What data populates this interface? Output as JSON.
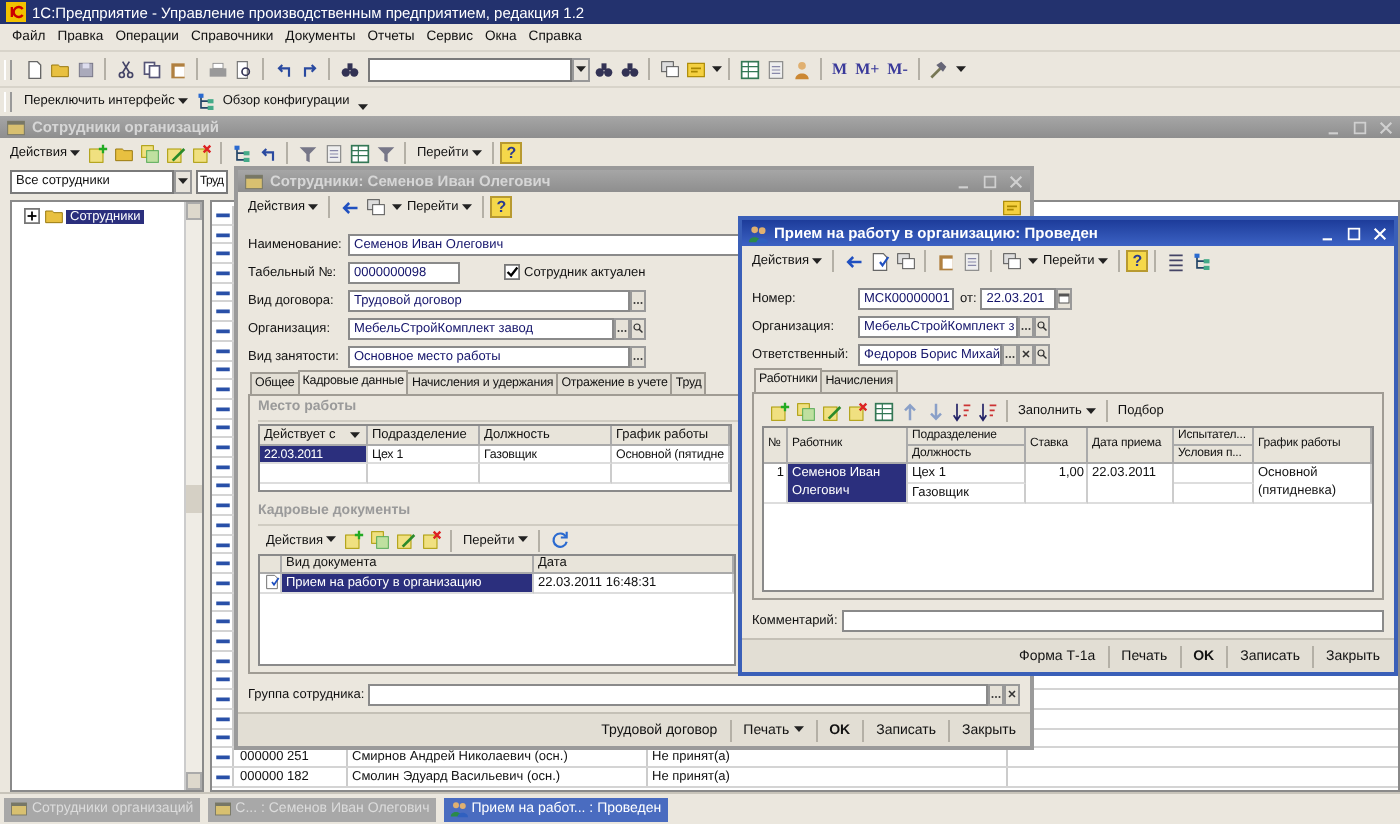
{
  "app_window": {
    "title": "1С:Предприятие - Управление производственным предприятием, редакция 1.2"
  },
  "menu": [
    "Файл",
    "Правка",
    "Операции",
    "Справочники",
    "Документы",
    "Отчеты",
    "Сервис",
    "Окна",
    "Справка"
  ],
  "toolbar": {
    "memory_buttons": [
      "M",
      "M+",
      "M-"
    ]
  },
  "panel": [
    {
      "label": "Переключить интерфейс",
      "kind": "menu"
    },
    {
      "label": "Обзор конфигурации",
      "kind": "link"
    }
  ],
  "employees_window": {
    "title": "Сотрудники организаций",
    "active": false,
    "actions": "Действия",
    "goto": "Перейти",
    "help": "?",
    "filter": "Все сотрудники",
    "filter_2": "Труд",
    "tree": [
      {
        "label": "Сотрудники",
        "expanded": false,
        "selected": true
      }
    ],
    "rows": [
      {
        "code": "000000 251",
        "name": "Смирнов Андрей Николаевич (осн.)",
        "status": "Не принят(а)"
      },
      {
        "code": "000000 182",
        "name": "Смолин Эдуард Васильевич (осн.)",
        "status": "Не принят(а)"
      }
    ]
  },
  "employee_form": {
    "title": "Сотрудники: Семенов Иван Олегович",
    "active": false,
    "actions": "Действия",
    "goto": "Перейти",
    "help": "?",
    "fields": [
      {
        "label": "Наименование:",
        "value": "Семенов Иван Олегович",
        "kind": "text"
      },
      {
        "label": "Табельный №:",
        "value": "0000000098",
        "kind": "short"
      },
      {
        "label": "Вид договора:",
        "value": "Трудовой договор",
        "kind": "select"
      },
      {
        "label": "Организация:",
        "value": "МебельСтройКомплект завод",
        "kind": "lookup"
      },
      {
        "label": "Вид занятости:",
        "value": "Основное место работы",
        "kind": "select"
      }
    ],
    "active_checkbox": {
      "label": "Сотрудник актуален",
      "checked": true
    },
    "tabs": [
      {
        "label": "Общее",
        "selected": false
      },
      {
        "label": "Кадровые данные",
        "selected": true
      },
      {
        "label": "Начисления и удержания",
        "selected": false
      },
      {
        "label": "Отражение в учете",
        "selected": false
      },
      {
        "label": "Труд",
        "selected": false
      }
    ],
    "workplace": {
      "title": "Место работы",
      "columns": [
        "Действует с",
        "Подразделение",
        "Должность",
        "График работы"
      ],
      "rows": [
        {
          "cells": [
            "22.03.2011",
            "Цех 1",
            "Газовщик",
            "Основной (пятидне"
          ],
          "selected": true
        }
      ]
    },
    "hr_documents": {
      "title": "Кадровые документы",
      "actions": "Действия",
      "goto": "Перейти",
      "columns": [
        "Вид документа",
        "Дата"
      ],
      "rows": [
        {
          "cells": [
            "Прием на работу в организацию",
            "22.03.2011 16:48:31"
          ],
          "selected": true
        }
      ]
    },
    "group": {
      "label": "Группа сотрудника:",
      "kind": "choice_clear"
    },
    "buttons": [
      {
        "label": "Трудовой договор",
        "kind": "plain"
      },
      {
        "label": "Печать",
        "kind": "menu"
      },
      {
        "label": "OK",
        "kind": "default"
      },
      {
        "label": "Записать",
        "kind": "plain"
      },
      {
        "label": "Закрыть",
        "kind": "plain"
      }
    ]
  },
  "document_form": {
    "title": "Прием на работу в организацию: Проведен",
    "active": true,
    "actions": "Действия",
    "goto": "Перейти",
    "help": "?",
    "number": {
      "label": "Номер:",
      "value": "МСК00000001"
    },
    "date": {
      "label": "от:",
      "value": "22.03.201"
    },
    "fields": [
      {
        "label": "Организация:",
        "value": "МебельСтройКомплект з",
        "kind": "lookup"
      },
      {
        "label": "Ответственный:",
        "value": "Федоров Борис Михай",
        "kind": "lookup_clear"
      }
    ],
    "tabs": [
      {
        "label": "Работники",
        "selected": true
      },
      {
        "label": "Начисления",
        "selected": false
      }
    ],
    "fill": "Заполнить",
    "pick": "Подбор",
    "columns": [
      {
        "top": "№"
      },
      {
        "top": "Работник"
      },
      {
        "top": "Подразделение",
        "bottom": "Должность"
      },
      {
        "top": "Ставка"
      },
      {
        "top": "Дата приема"
      },
      {
        "top": "Испытател...",
        "bottom": "Условия п..."
      },
      {
        "top": "График работы"
      }
    ],
    "rows": [
      {
        "cells": [
          {
            "text": "1",
            "kind": "number",
            "selected": false
          },
          {
            "text": "Семенов Иван Олегович",
            "kind": "text",
            "selected": true
          },
          {
            "text": "Цех 1",
            "text2": "Газовщик",
            "kind": "text",
            "selected": false
          },
          {
            "text": "1,00",
            "kind": "number",
            "selected": false
          },
          {
            "text": "22.03.2011",
            "kind": "text",
            "selected": false
          },
          {
            "kind": "text",
            "selected": false
          },
          {
            "text": "Основной (пятидневка)",
            "kind": "text",
            "selected": false
          }
        ]
      }
    ],
    "comment": {
      "label": "Комментарий:"
    },
    "buttons": [
      {
        "label": "Форма Т-1а",
        "kind": "plain"
      },
      {
        "label": "Печать",
        "kind": "plain"
      },
      {
        "label": "OK",
        "kind": "default"
      },
      {
        "label": "Записать",
        "kind": "plain"
      },
      {
        "label": "Закрыть",
        "kind": "plain"
      }
    ]
  },
  "taskbar": [
    {
      "label": "Сотрудники организаций",
      "selected": false
    },
    {
      "label": "С... : Семенов Иван Олегович",
      "selected": false
    },
    {
      "label": "Прием на работ... : Проведен",
      "selected": true
    }
  ]
}
